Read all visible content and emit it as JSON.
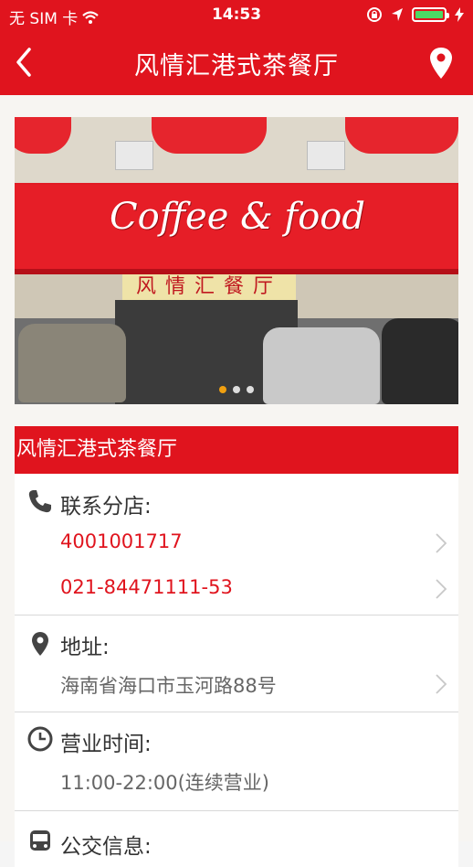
{
  "status_bar": {
    "carrier": "无 SIM 卡",
    "time": "14:53"
  },
  "nav": {
    "title": "风情汇港式茶餐厅",
    "back_icon": "chevron-left-icon",
    "location_icon": "location-pin-icon"
  },
  "banner": {
    "sign_text": "Coffee & food",
    "store_sign": "风情汇餐厅",
    "page_count": 3,
    "active_page": 1
  },
  "restaurant": {
    "name": "风情汇港式茶餐厅"
  },
  "sections": {
    "phone": {
      "title": "联系分店:",
      "icon": "phone-icon",
      "numbers": [
        "4001001717",
        "021-84471111-53"
      ]
    },
    "address": {
      "title": "地址:",
      "icon": "map-pin-icon",
      "value": "海南省海口市玉河路88号"
    },
    "hours": {
      "title": "营业时间:",
      "icon": "clock-icon",
      "value": "11:00-22:00(连续营业)"
    },
    "bus": {
      "title": "公交信息:",
      "icon": "bus-icon"
    }
  },
  "colors": {
    "brand": "#e0141e",
    "battery": "#4cd964"
  }
}
